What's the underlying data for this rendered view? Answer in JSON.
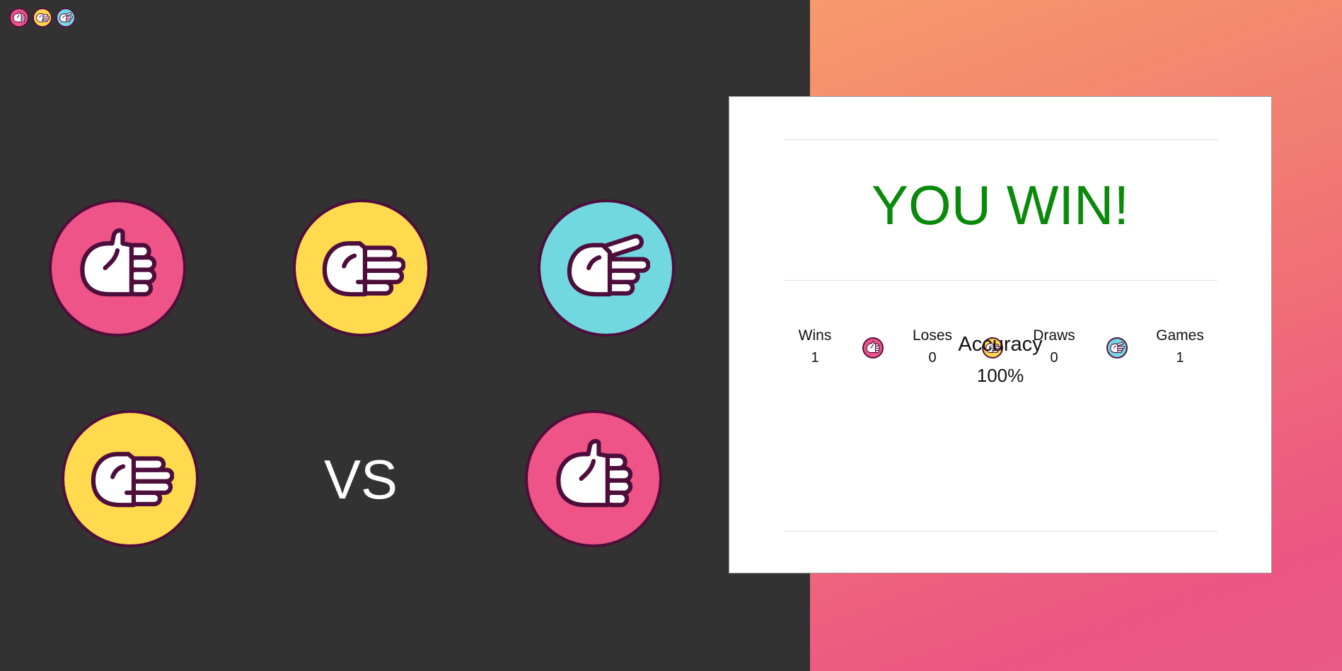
{
  "colors": {
    "background": "#323232",
    "rock": "#ee5487",
    "paper": "#ffd94e",
    "scissors": "#72d8e0",
    "outline": "#4d0e3c",
    "win_text": "#0a8a0a"
  },
  "header_icons": [
    {
      "name": "rock-icon",
      "color": "#ee5487"
    },
    {
      "name": "paper-icon",
      "color": "#ffd94e"
    },
    {
      "name": "scissors-icon",
      "color": "#72d8e0"
    }
  ],
  "choices": [
    {
      "name": "rock",
      "color": "#ee5487"
    },
    {
      "name": "paper",
      "color": "#ffd94e"
    },
    {
      "name": "scissors",
      "color": "#72d8e0"
    }
  ],
  "battle": {
    "player": "paper",
    "vs_label": "VS",
    "opponent": "rock"
  },
  "result": {
    "title": "YOU WIN!",
    "stats": [
      {
        "label": "Wins",
        "value": "1"
      },
      {
        "label": "Loses",
        "value": "0"
      },
      {
        "label": "Draws",
        "value": "0"
      },
      {
        "label": "Games",
        "value": "1"
      }
    ],
    "accuracy_label": "Accuracy",
    "accuracy_value": "100%"
  }
}
